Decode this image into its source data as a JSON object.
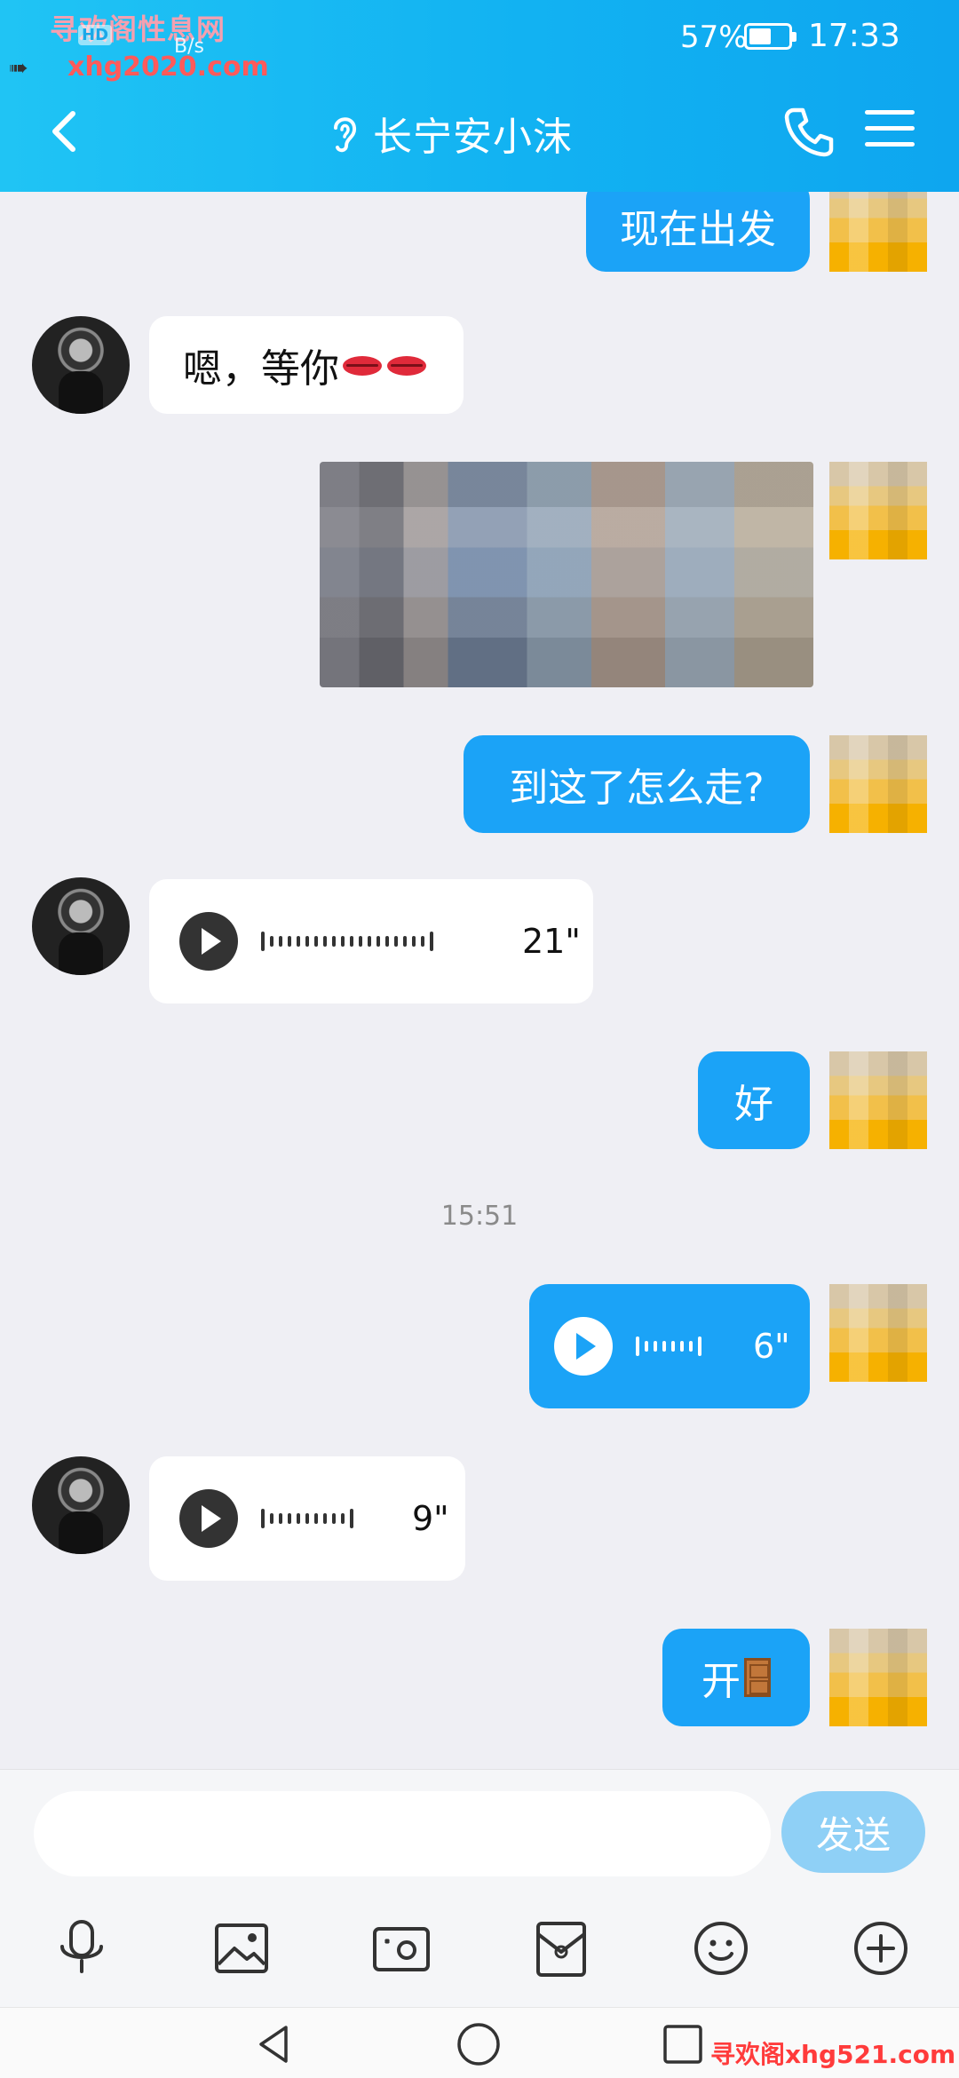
{
  "status_bar": {
    "watermark_top": "寻欢阁性息网",
    "watermark_url": "xhg2020.com",
    "hd_badge": "HD",
    "net_speed": "B/s",
    "battery_percent": "57%",
    "battery_level": 0.57,
    "time": "17:33"
  },
  "header": {
    "title": "长宁安小沫",
    "icons": [
      "back-icon",
      "ear-icon",
      "phone-icon",
      "menu-icon"
    ]
  },
  "messages": [
    {
      "side": "right",
      "type": "text",
      "text": "现在出发"
    },
    {
      "side": "left",
      "type": "text",
      "text": "嗯，等你",
      "emoji": "lips-emoji"
    },
    {
      "side": "right",
      "type": "image"
    },
    {
      "side": "right",
      "type": "text",
      "text": "到这了怎么走?"
    },
    {
      "side": "left",
      "type": "voice",
      "duration": "21\""
    },
    {
      "side": "right",
      "type": "text",
      "text": "好"
    },
    {
      "side": "center",
      "type": "timestamp",
      "text": "15:51"
    },
    {
      "side": "right",
      "type": "voice",
      "duration": "6\""
    },
    {
      "side": "left",
      "type": "voice",
      "duration": "9\""
    },
    {
      "side": "right",
      "type": "text",
      "text": "开",
      "emoji": "door-emoji"
    }
  ],
  "input": {
    "value": "",
    "placeholder": "",
    "send_label": "发送"
  },
  "toolbar": {
    "items": [
      "microphone-icon",
      "image-icon",
      "camera-icon",
      "red-packet-icon",
      "emoji-icon",
      "plus-icon"
    ]
  },
  "system_nav": {
    "items": [
      "back-triangle-icon",
      "home-circle-icon",
      "recents-square-icon"
    ],
    "watermark_bottom": "寻欢阁xhg521.com"
  },
  "colors": {
    "header": "#12b2f2",
    "outgoing_bubble": "#1ba3f7",
    "incoming_bubble": "#ffffff",
    "background": "#efeff4",
    "send_button": "#8fd0f6"
  }
}
